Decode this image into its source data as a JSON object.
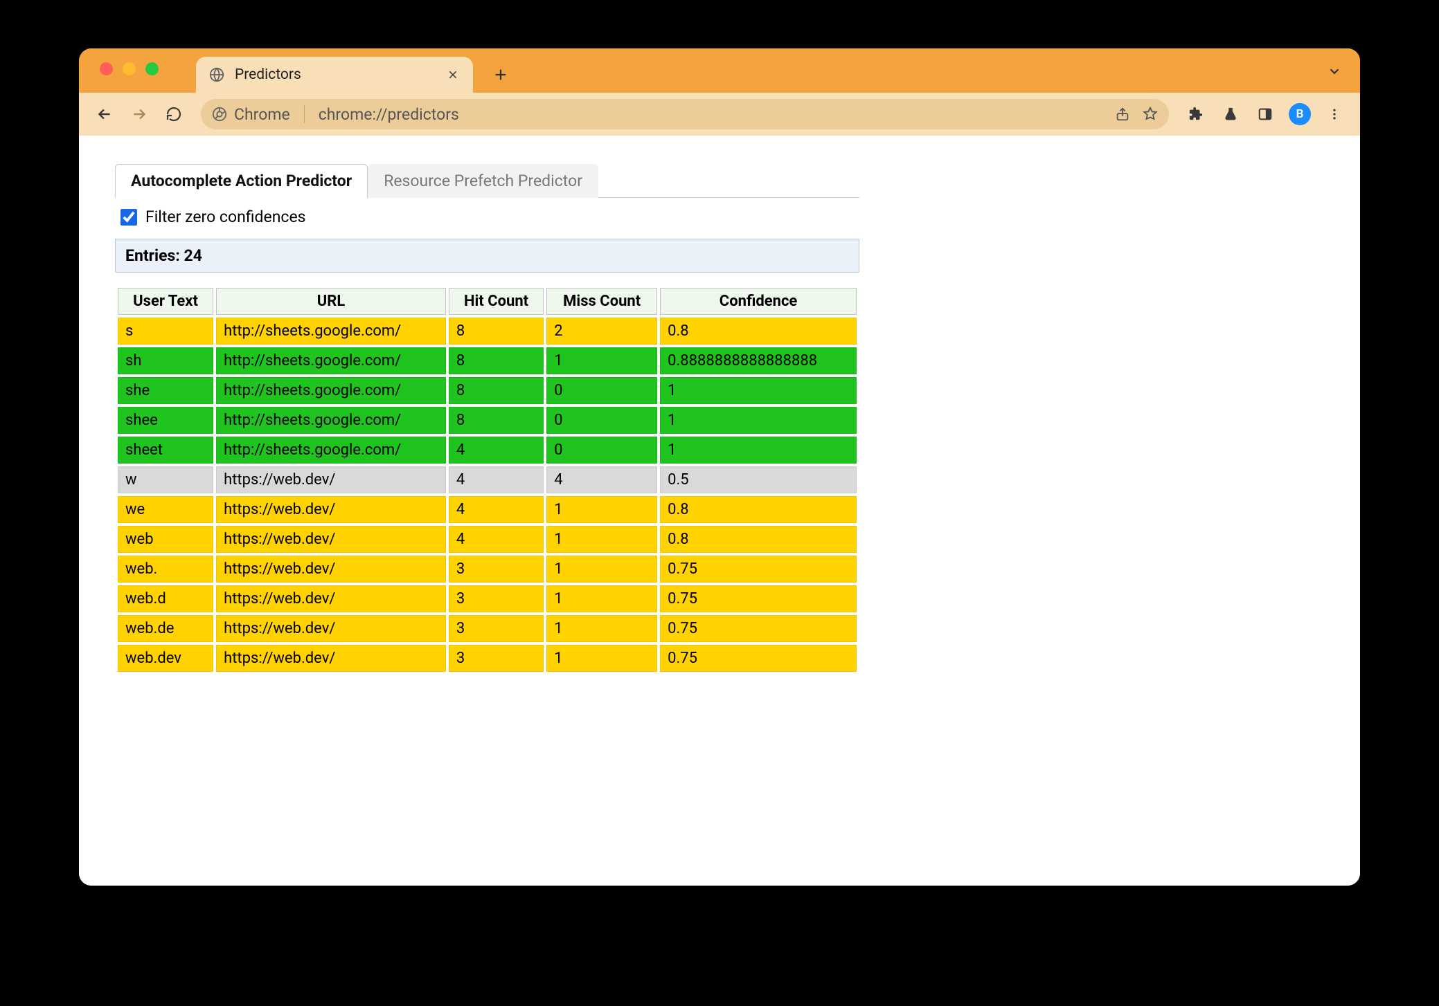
{
  "browser": {
    "tab_title": "Predictors",
    "omnibox_scheme_label": "Chrome",
    "omnibox_url": "chrome://predictors",
    "avatar_letter": "B"
  },
  "page": {
    "tabs": [
      {
        "label": "Autocomplete Action Predictor",
        "active": true
      },
      {
        "label": "Resource Prefetch Predictor",
        "active": false
      }
    ],
    "filter_label": "Filter zero confidences",
    "filter_checked": true,
    "entries_label": "Entries: 24",
    "columns": [
      "User Text",
      "URL",
      "Hit Count",
      "Miss Count",
      "Confidence"
    ],
    "rows": [
      {
        "user_text": "s",
        "url": "http://sheets.google.com/",
        "hit": "8",
        "miss": "2",
        "conf": "0.8",
        "cls": "yellow"
      },
      {
        "user_text": "sh",
        "url": "http://sheets.google.com/",
        "hit": "8",
        "miss": "1",
        "conf": "0.8888888888888888",
        "cls": "green"
      },
      {
        "user_text": "she",
        "url": "http://sheets.google.com/",
        "hit": "8",
        "miss": "0",
        "conf": "1",
        "cls": "green"
      },
      {
        "user_text": "shee",
        "url": "http://sheets.google.com/",
        "hit": "8",
        "miss": "0",
        "conf": "1",
        "cls": "green"
      },
      {
        "user_text": "sheet",
        "url": "http://sheets.google.com/",
        "hit": "4",
        "miss": "0",
        "conf": "1",
        "cls": "green"
      },
      {
        "user_text": "w",
        "url": "https://web.dev/",
        "hit": "4",
        "miss": "4",
        "conf": "0.5",
        "cls": "gray"
      },
      {
        "user_text": "we",
        "url": "https://web.dev/",
        "hit": "4",
        "miss": "1",
        "conf": "0.8",
        "cls": "yellow"
      },
      {
        "user_text": "web",
        "url": "https://web.dev/",
        "hit": "4",
        "miss": "1",
        "conf": "0.8",
        "cls": "yellow"
      },
      {
        "user_text": "web.",
        "url": "https://web.dev/",
        "hit": "3",
        "miss": "1",
        "conf": "0.75",
        "cls": "yellow"
      },
      {
        "user_text": "web.d",
        "url": "https://web.dev/",
        "hit": "3",
        "miss": "1",
        "conf": "0.75",
        "cls": "yellow"
      },
      {
        "user_text": "web.de",
        "url": "https://web.dev/",
        "hit": "3",
        "miss": "1",
        "conf": "0.75",
        "cls": "yellow"
      },
      {
        "user_text": "web.dev",
        "url": "https://web.dev/",
        "hit": "3",
        "miss": "1",
        "conf": "0.75",
        "cls": "yellow"
      }
    ]
  }
}
